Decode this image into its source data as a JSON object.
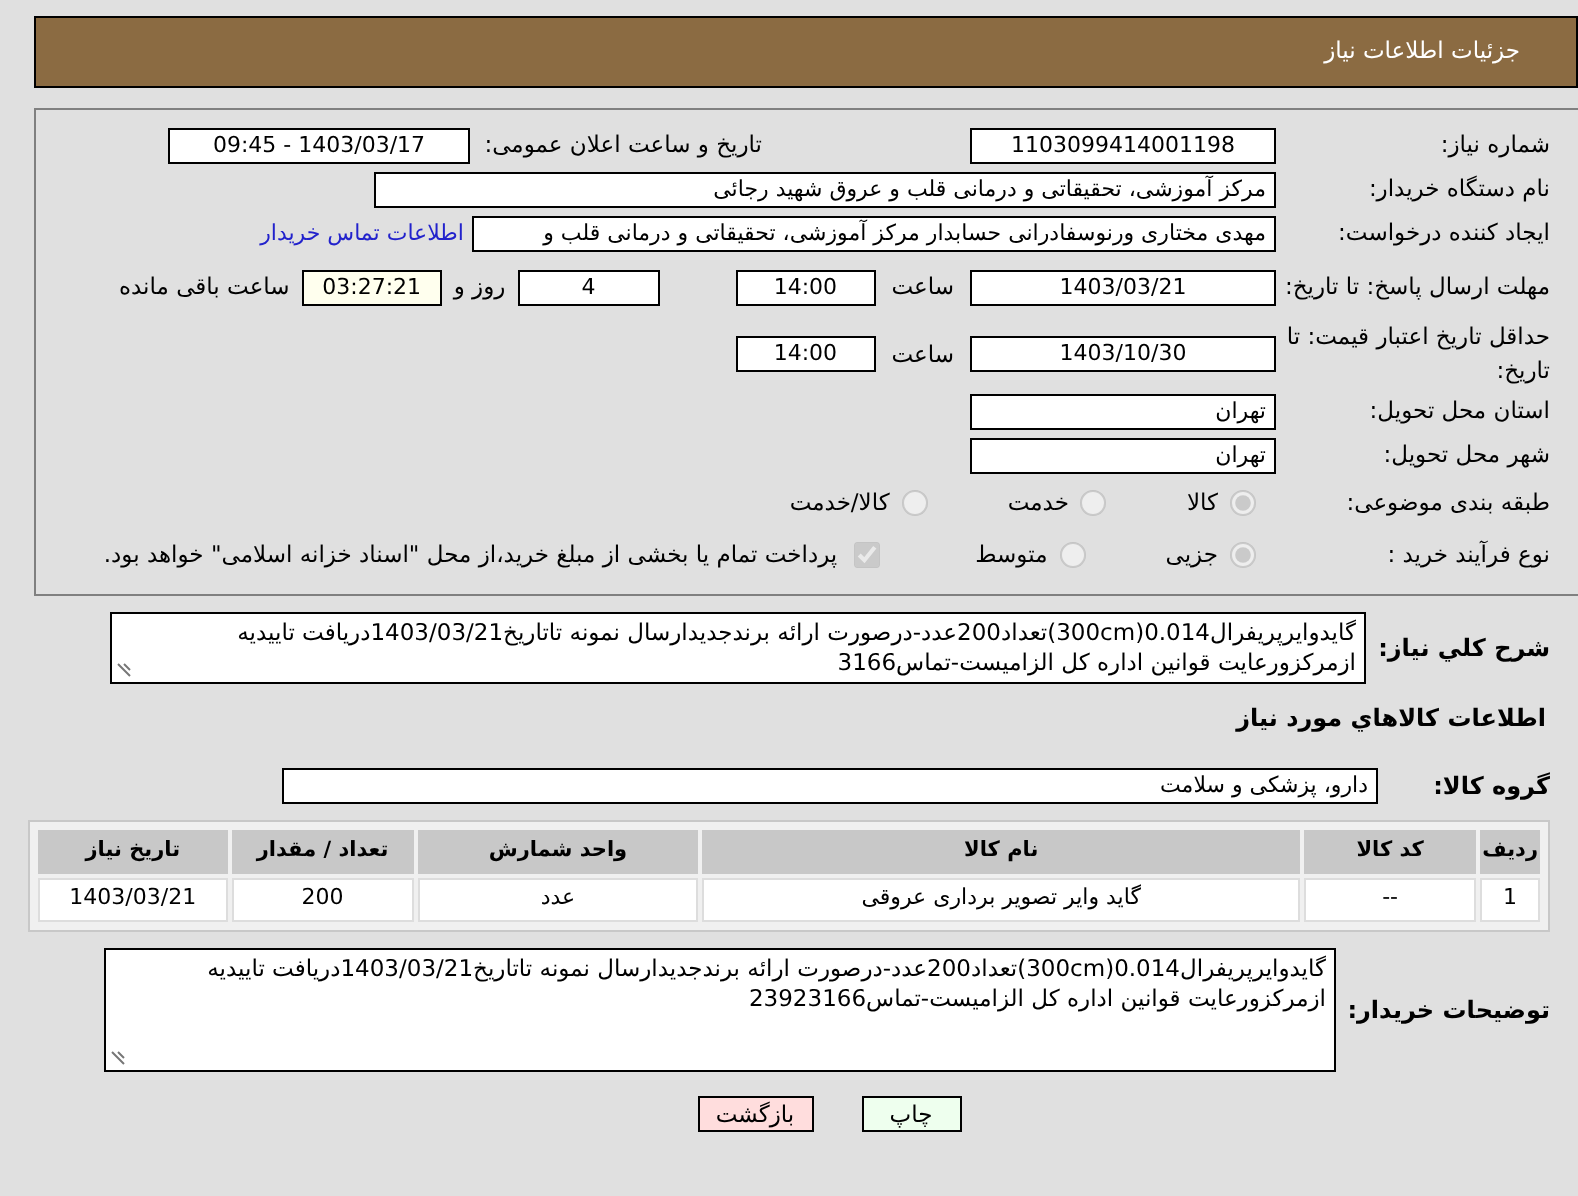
{
  "header": {
    "title": "جزئیات اطلاعات نیاز"
  },
  "need_number": {
    "label": "شماره نیاز:",
    "value": "1103099414001198"
  },
  "announce": {
    "label": "تاریخ و ساعت اعلان عمومی:",
    "value": "1403/03/17 - 09:45"
  },
  "buyer_org": {
    "label": "نام دستگاه خریدار:",
    "value": "مرکز آموزشی، تحقیقاتی و درمانی قلب و عروق شهید رجائی"
  },
  "requester": {
    "label": "ایجاد کننده درخواست:",
    "value": "مهدی مختاری ورنوسفادرانی حسابدار مرکز آموزشی، تحقیقاتی و درمانی قلب و",
    "link": "اطلاعات تماس خریدار"
  },
  "reply_deadline": {
    "label": "مهلت ارسال پاسخ: تا تاریخ:",
    "date": "1403/03/21",
    "time_label": "ساعت",
    "time": "14:00",
    "days": "4",
    "days_label": "روز و",
    "remaining": "03:27:21",
    "remaining_label": "ساعت باقی مانده"
  },
  "price_validity": {
    "label": "حداقل تاریخ اعتبار قیمت: تا تاریخ:",
    "date": "1403/10/30",
    "time_label": "ساعت",
    "time": "14:00"
  },
  "province": {
    "label": "استان محل تحویل:",
    "value": "تهران"
  },
  "city": {
    "label": "شهر محل تحویل:",
    "value": "تهران"
  },
  "category": {
    "label": "طبقه بندی موضوعی:",
    "options": [
      {
        "label": "کالا",
        "selected": true
      },
      {
        "label": "خدمت",
        "selected": false
      },
      {
        "label": "کالا/خدمت",
        "selected": false
      }
    ]
  },
  "process": {
    "label": "نوع فرآیند خرید :",
    "options": [
      {
        "label": "جزیی",
        "selected": true
      },
      {
        "label": "متوسط",
        "selected": false
      }
    ],
    "treasury": {
      "checked": true,
      "text": "پرداخت تمام یا بخشی از مبلغ خرید،از محل \"اسناد خزانه اسلامی\" خواهد بود."
    }
  },
  "description": {
    "label": "شرح کلي نياز:",
    "text": "گایدوایرپریفرال0.014(300cm)تعداد200عدد-درصورت ارائه برندجدیدارسال نمونه تاتاریخ1403/03/21دریافت تاییدیه ازمرکزورعایت قوانین اداره کل الزامیست-تماس3166"
  },
  "items_heading": "اطلاعات کالاهاي مورد نياز",
  "goods_group": {
    "label": "گروه کالا:",
    "value": "دارو، پزشکی و سلامت"
  },
  "table": {
    "columns": [
      "رديف",
      "کد کالا",
      "نام کالا",
      "واحد شمارش",
      "تعداد / مقدار",
      "تاریخ نیاز"
    ],
    "rows": [
      [
        "1",
        "--",
        "گاید وایر تصویر برداری عروقی",
        "عدد",
        "200",
        "1403/03/21"
      ]
    ]
  },
  "buyer_notes": {
    "label": "توضیحات خریدار:",
    "text": "گایدوایرپریفرال0.014(300cm)تعداد200عدد-درصورت ارائه برندجدیدارسال نمونه تاتاریخ1403/03/21دریافت تاییدیه ازمرکزورعایت قوانین اداره کل الزامیست-تماس23923166"
  },
  "buttons": [
    {
      "label": "چاپ",
      "kind": "print"
    },
    {
      "label": "بازگشت",
      "kind": "back"
    }
  ]
}
